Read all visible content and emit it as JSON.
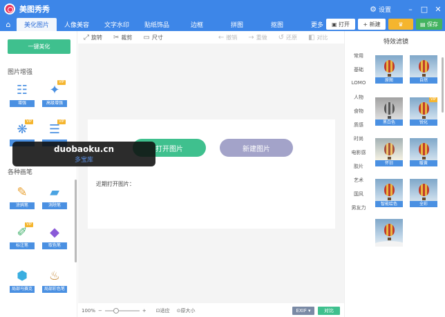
{
  "app": {
    "title": "美图秀秀",
    "settings_label": "设置"
  },
  "nav": {
    "tabs": [
      "美化图片",
      "人像美容",
      "文字水印",
      "贴纸饰品",
      "边框",
      "拼图",
      "抠图",
      "更多"
    ],
    "open_label": "打开",
    "new_label": "新建",
    "save_label": "保存"
  },
  "left": {
    "beautify_label": "一键美化",
    "section1": "图片增强",
    "section2": "各种画笔",
    "tools": [
      {
        "label": "增强",
        "vip": false
      },
      {
        "label": "高级增强",
        "vip": true
      },
      {
        "label": "",
        "vip": true
      },
      {
        "label": "",
        "vip": true
      },
      {
        "label": "涂鸦笔",
        "vip": false
      },
      {
        "label": "消除笔",
        "vip": false
      },
      {
        "label": "标注笔",
        "vip": true
      },
      {
        "label": "取色笔",
        "vip": false
      },
      {
        "label": "局部马赛克",
        "vip": false
      },
      {
        "label": "局部彩色笔",
        "vip": false
      }
    ],
    "vip_badge": "VIP"
  },
  "toolbar": {
    "rotate": "旋转",
    "crop": "裁剪",
    "size": "尺寸",
    "undo": "撤销",
    "redo": "重做",
    "reset": "还原",
    "compare": "对比"
  },
  "canvas": {
    "open_image": "打开图片",
    "new_image": "新建图片",
    "recent": "近期打开图片："
  },
  "status": {
    "zoom": "100%",
    "fit": "适应",
    "original": "原大小",
    "exif": "EXIF",
    "compare": "对比"
  },
  "right": {
    "title": "特效滤镜",
    "categories": [
      "常用",
      "基础",
      "LOMO",
      "人物",
      "食物",
      "质感",
      "时尚",
      "电影感",
      "胶片",
      "艺术",
      "国风",
      "男友力"
    ],
    "filters": [
      {
        "label": "原图",
        "vip": false
      },
      {
        "label": "自然",
        "vip": false
      },
      {
        "label": "黑白色",
        "vip": false
      },
      {
        "label": "锐化",
        "vip": true
      },
      {
        "label": "怀旧",
        "vip": false
      },
      {
        "label": "暖黄",
        "vip": false
      },
      {
        "label": "智能绘色",
        "vip": false
      },
      {
        "label": "全彩",
        "vip": false
      },
      {
        "label": "",
        "vip": false
      }
    ]
  },
  "watermark": {
    "line1": "duobaoku.cn",
    "line2": "多宝库"
  }
}
